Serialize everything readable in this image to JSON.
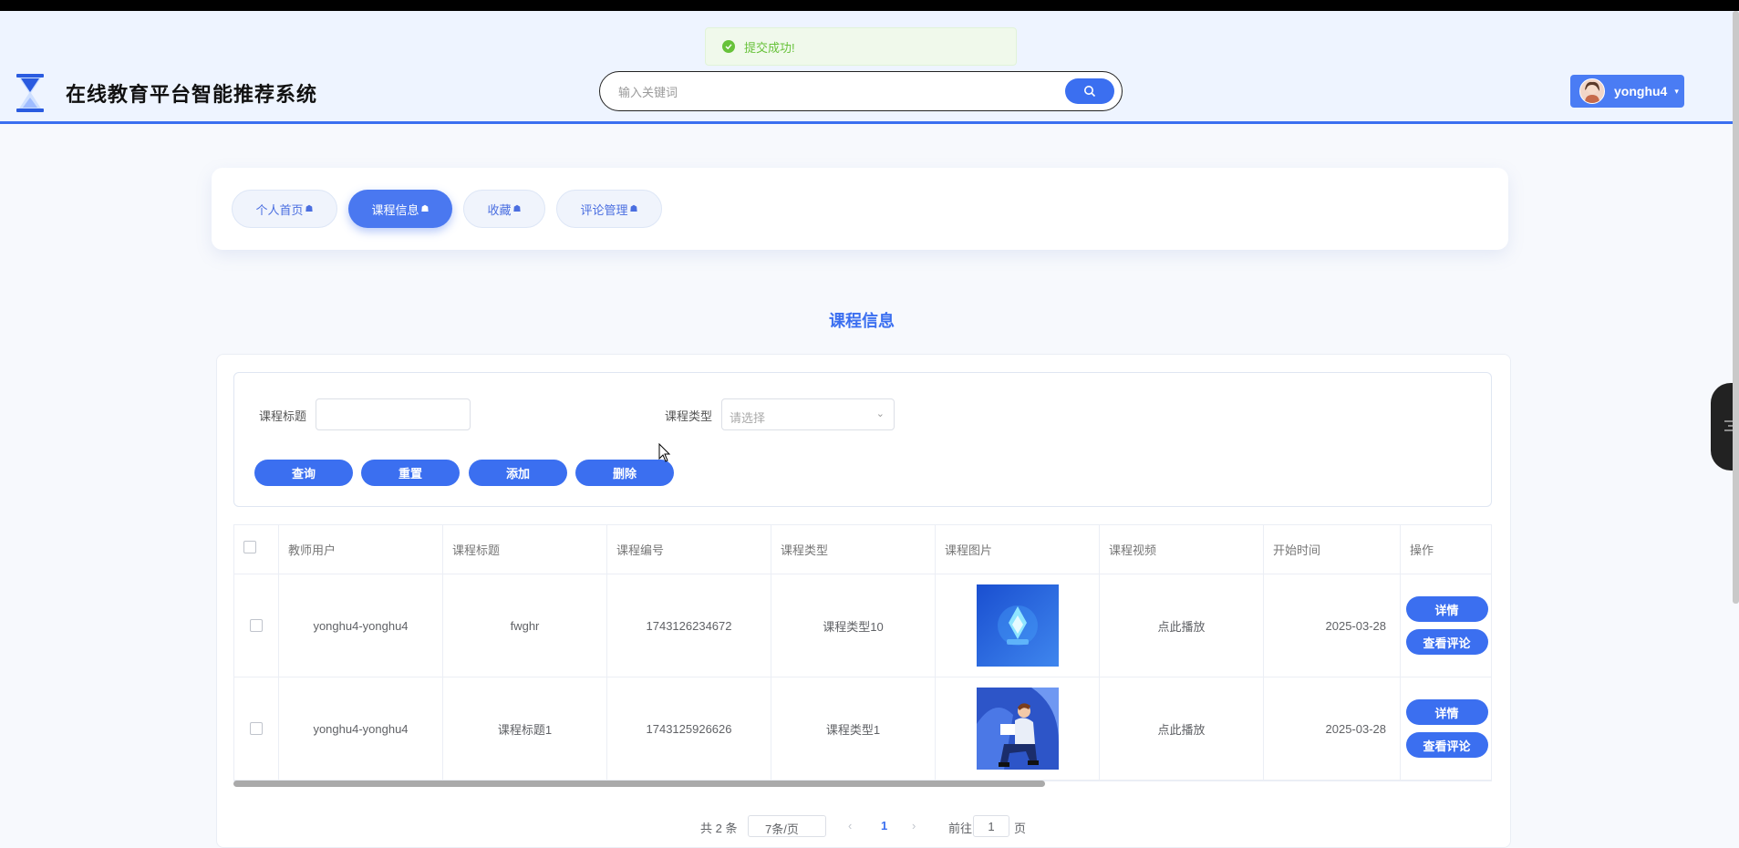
{
  "header": {
    "site_title": "在线教育平台智能推荐系统",
    "search_placeholder": "输入关键词",
    "username": "yonghu4"
  },
  "toast": {
    "message": "提交成功!"
  },
  "tabs": [
    {
      "label": "个人首页"
    },
    {
      "label": "课程信息"
    },
    {
      "label": "收藏"
    },
    {
      "label": "评论管理"
    }
  ],
  "page_title": "课程信息",
  "filters": {
    "title_label": "课程标题",
    "title_value": "",
    "type_label": "课程类型",
    "type_placeholder": "请选择"
  },
  "buttons": {
    "query": "查询",
    "reset": "重置",
    "add": "添加",
    "delete": "删除"
  },
  "table": {
    "headers": [
      "教师用户",
      "课程标题",
      "课程编号",
      "课程类型",
      "课程图片",
      "课程视频",
      "开始时间",
      "操作"
    ],
    "rows": [
      {
        "teacher": "yonghu4-yonghu4",
        "title": "fwghr",
        "number": "1743126234672",
        "type": "课程类型10",
        "video": "点此播放",
        "start": "2025-03-28",
        "detail": "详情",
        "comments": "查看评论"
      },
      {
        "teacher": "yonghu4-yonghu4",
        "title": "课程标题1",
        "number": "1743125926626",
        "type": "课程类型1",
        "video": "点此播放",
        "start": "2025-03-28",
        "detail": "详情",
        "comments": "查看评论"
      }
    ]
  },
  "pagination": {
    "total": "共 2 条",
    "page_size": "7条/页",
    "current_page": "1",
    "goto_label": "前往",
    "goto_value": "1",
    "page_suffix": "页"
  },
  "colors": {
    "accent": "#3b6ff0",
    "success": "#67c23a"
  }
}
